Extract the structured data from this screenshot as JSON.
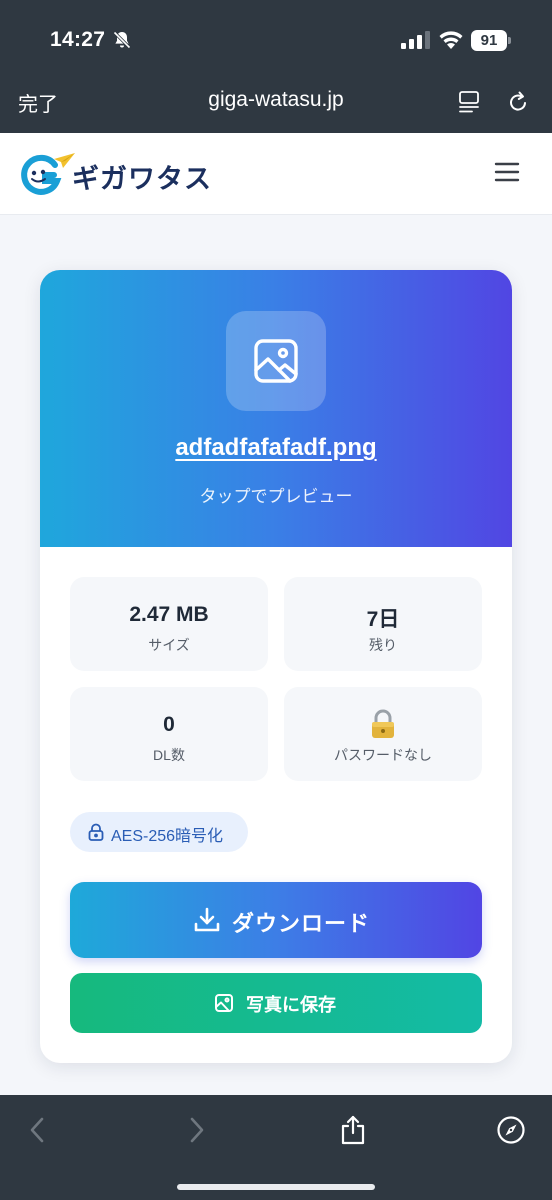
{
  "status_bar": {
    "time": "14:27",
    "battery": "91",
    "icons": [
      "bell-slash-icon",
      "signal-icon",
      "wifi-icon",
      "battery-icon"
    ]
  },
  "browser": {
    "done_label": "完了",
    "url": "giga-watasu.jp",
    "icons": [
      "reader-icon",
      "reload-icon",
      "back-icon",
      "forward-icon",
      "share-icon",
      "compass-icon"
    ]
  },
  "site": {
    "logo_text": "ギガワタス",
    "menu_icon": "hamburger-icon"
  },
  "file": {
    "name": "adfadfafafadf.png",
    "preview_hint": "タップでプレビュー",
    "file_icon": "image-icon"
  },
  "stats": [
    {
      "value": "2.47 MB",
      "label": "サイズ"
    },
    {
      "value": "7日",
      "label": "残り"
    },
    {
      "value": "0",
      "label": "DL数"
    },
    {
      "value": "",
      "label": "パスワードなし",
      "icon": "lock-icon"
    }
  ],
  "encryption": {
    "label": "AES-256暗号化"
  },
  "actions": {
    "download_label": "ダウンロード",
    "save_photo_label": "写真に保存"
  },
  "colors": {
    "topbar": "#2f3841",
    "gradient_start": "#1fa7dc",
    "gradient_end": "#5146e3",
    "save_green": "#16b97d",
    "logo_navy": "#1b2f5e"
  }
}
